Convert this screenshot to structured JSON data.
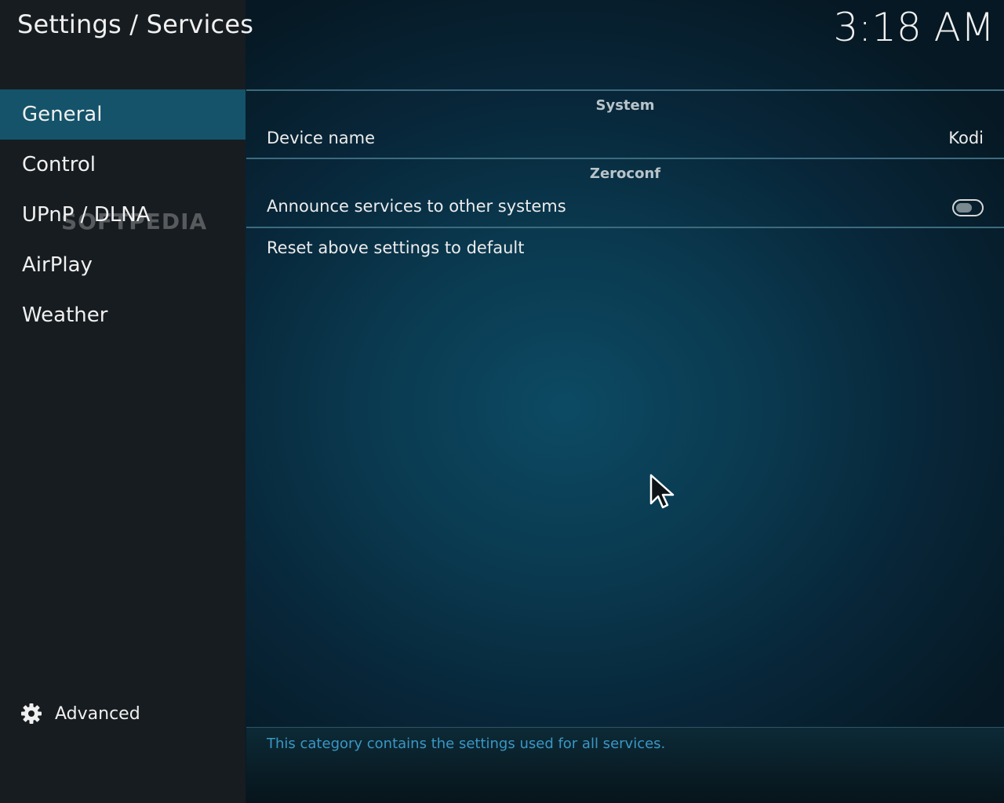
{
  "header": {
    "breadcrumb": "Settings / Services",
    "clock": "3:18 AM"
  },
  "sidebar": {
    "items": [
      {
        "label": "General",
        "active": true
      },
      {
        "label": "Control",
        "active": false
      },
      {
        "label": "UPnP / DLNA",
        "active": false
      },
      {
        "label": "AirPlay",
        "active": false
      },
      {
        "label": "Weather",
        "active": false
      }
    ],
    "advanced_label": "Advanced",
    "advanced_icon": "gear-icon"
  },
  "watermark": "SOFTPEDIA",
  "main": {
    "sections": [
      {
        "title": "System",
        "settings": [
          {
            "label": "Device name",
            "value": "Kodi"
          }
        ]
      },
      {
        "title": "Zeroconf",
        "settings": [
          {
            "label": "Announce services to other systems",
            "toggle": "off"
          }
        ]
      }
    ],
    "reset_label": "Reset above settings to default",
    "description": "This category contains the settings used for all services."
  },
  "colors": {
    "active_item": "#14536a",
    "sidebar_bg": "#171c20",
    "description_text": "#3a97c6"
  }
}
